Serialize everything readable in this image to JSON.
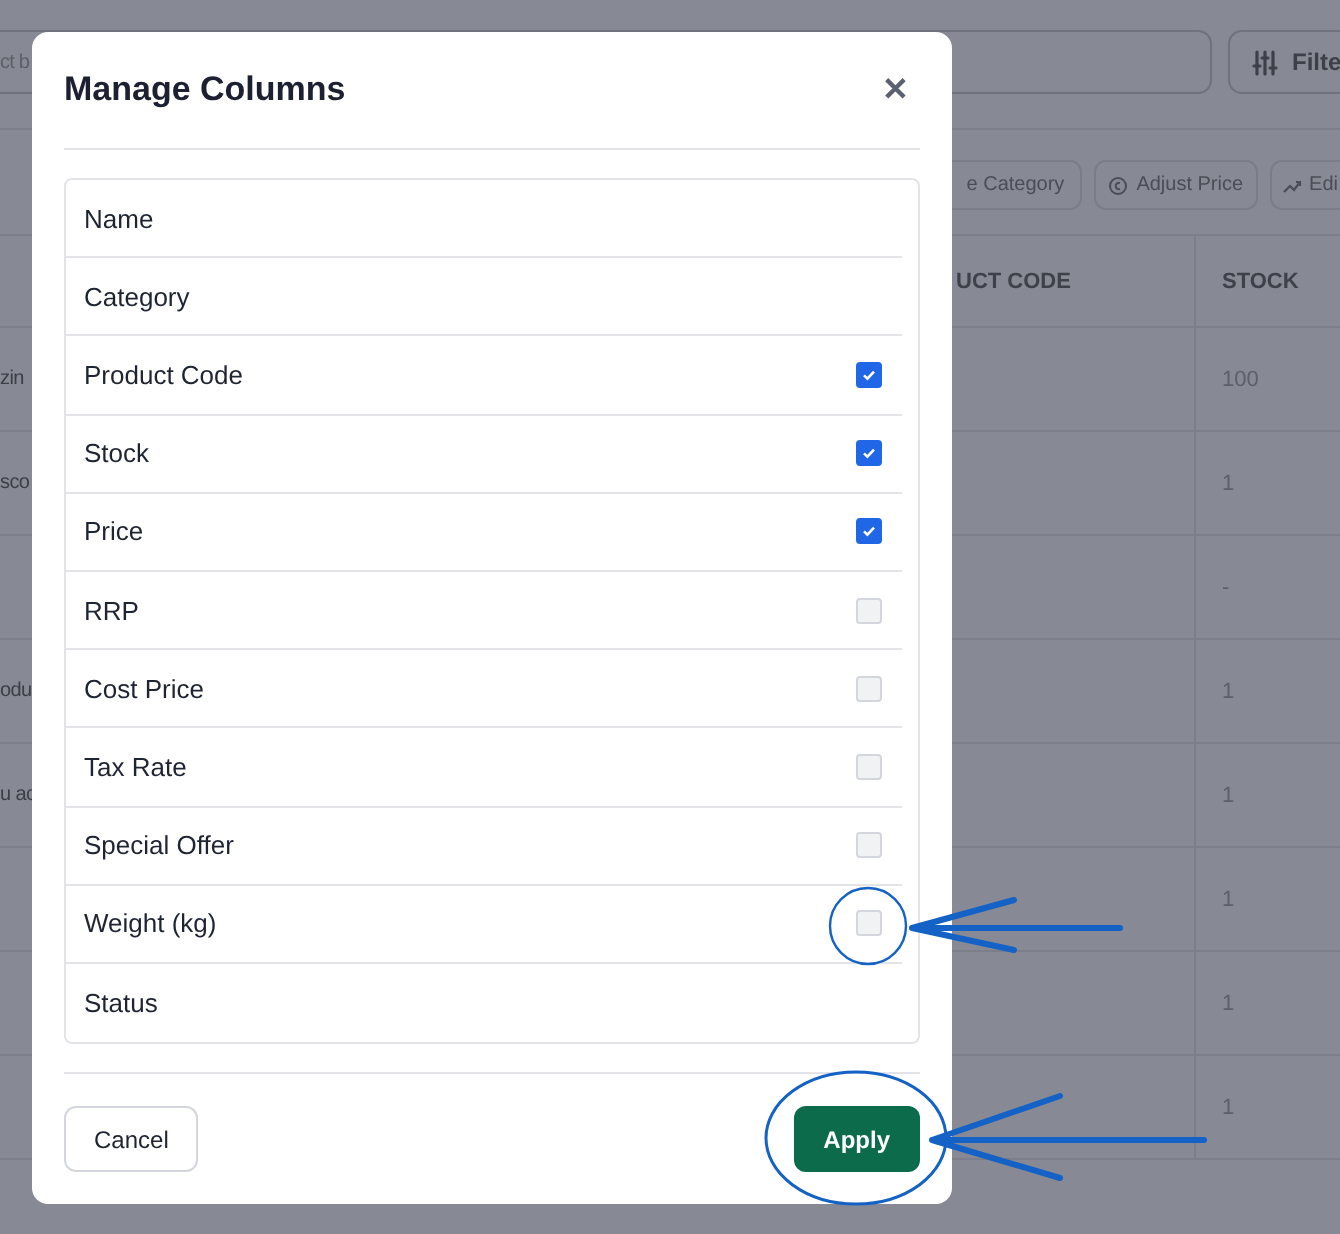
{
  "background": {
    "search": {
      "value": "ct b"
    },
    "filter_button": {
      "label": "Filte"
    },
    "toolbar": [
      {
        "label": "e Category"
      },
      {
        "label": "Adjust Price"
      },
      {
        "label": "Edi"
      }
    ],
    "table": {
      "columns": [
        "UCT CODE",
        "STOCK"
      ],
      "rows": [
        {
          "column_1": "zin",
          "stock": "100"
        },
        {
          "column_1": "sco",
          "stock": "1"
        },
        {
          "column_1": "",
          "stock": "-"
        },
        {
          "column_1": "odu",
          "stock": "1"
        },
        {
          "column_1": "u ac",
          "stock": "1"
        },
        {
          "column_1": "",
          "stock": "1"
        },
        {
          "column_1": "",
          "stock": "1"
        },
        {
          "column_1": "",
          "stock": "1"
        }
      ]
    }
  },
  "dialog": {
    "title": "Manage Columns",
    "close": "✕",
    "columns": [
      {
        "label": "Name",
        "kind": "fixed"
      },
      {
        "label": "Category",
        "kind": "fixed"
      },
      {
        "label": "Product Code",
        "kind": "checkbox",
        "checked": true
      },
      {
        "label": "Stock",
        "kind": "checkbox",
        "checked": true
      },
      {
        "label": "Price",
        "kind": "checkbox",
        "checked": true
      },
      {
        "label": "RRP",
        "kind": "checkbox",
        "checked": false
      },
      {
        "label": "Cost Price",
        "kind": "checkbox",
        "checked": false
      },
      {
        "label": "Tax Rate",
        "kind": "checkbox",
        "checked": false
      },
      {
        "label": "Special Offer",
        "kind": "checkbox",
        "checked": false
      },
      {
        "label": "Weight (kg)",
        "kind": "checkbox",
        "checked": false
      },
      {
        "label": "Status",
        "kind": "fixed"
      }
    ],
    "buttons": [
      {
        "label": "Cancel",
        "kind": "secondary"
      },
      {
        "label": "Apply",
        "kind": "primary"
      }
    ]
  }
}
